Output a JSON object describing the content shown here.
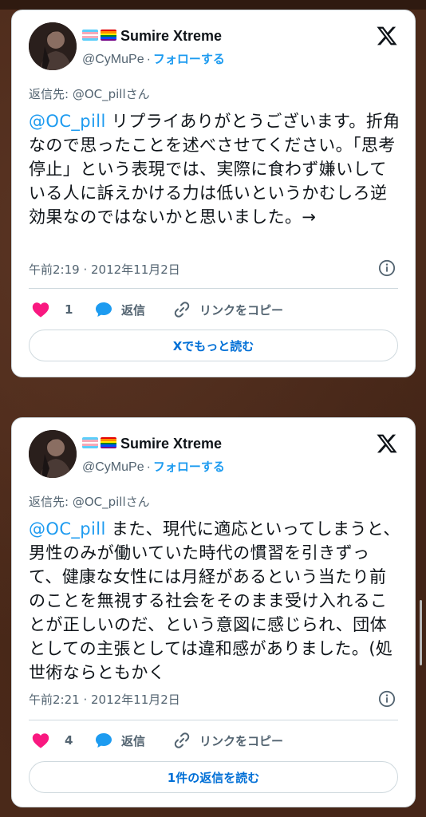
{
  "colors": {
    "accent": "#1d9bf0",
    "link_button": "#006fd6",
    "heart": "#f91880",
    "text": "#0f1419",
    "muted": "#536471",
    "background": "#4a2919"
  },
  "tweets": [
    {
      "display_name": "Sumire Xtreme",
      "handle": "@CyMuPe",
      "separator": "·",
      "follow_label": "フォローする",
      "flag_icons": [
        "transgender-flag-icon",
        "rainbow-flag-icon"
      ],
      "reply_to": "返信先: @OC_pillさん",
      "mention": "@OC_pill",
      "text": " リプライありがとうございます。折角なので思ったことを述べさせてください。「思考停止」という表現では、実際に食わず嫌いしている人に訴えかける力は低いというかむしろ逆効果なのではないかと思いました。→",
      "timestamp": "午前2:19 · 2012年11月2日",
      "like_count": "1",
      "reply_label": "返信",
      "copy_link_label": "リンクをコピー",
      "action_button_label": "Xでもっと読む"
    },
    {
      "display_name": "Sumire Xtreme",
      "handle": "@CyMuPe",
      "separator": "·",
      "follow_label": "フォローする",
      "flag_icons": [
        "transgender-flag-icon",
        "rainbow-flag-icon"
      ],
      "reply_to": "返信先: @OC_pillさん",
      "mention": "@OC_pill",
      "text": " また、現代に適応といってしまうと、男性のみが働いていた時代の慣習を引きずって、健康な女性には月経があるという当たり前のことを無視する社会をそのまま受け入れることが正しいのだ、という意図に感じられ、団体としての主張としては違和感がありました。(処世術ならともかく",
      "timestamp": "午前2:21 · 2012年11月2日",
      "like_count": "4",
      "reply_label": "返信",
      "copy_link_label": "リンクをコピー",
      "action_button_label": "1件の返信を読む"
    }
  ]
}
